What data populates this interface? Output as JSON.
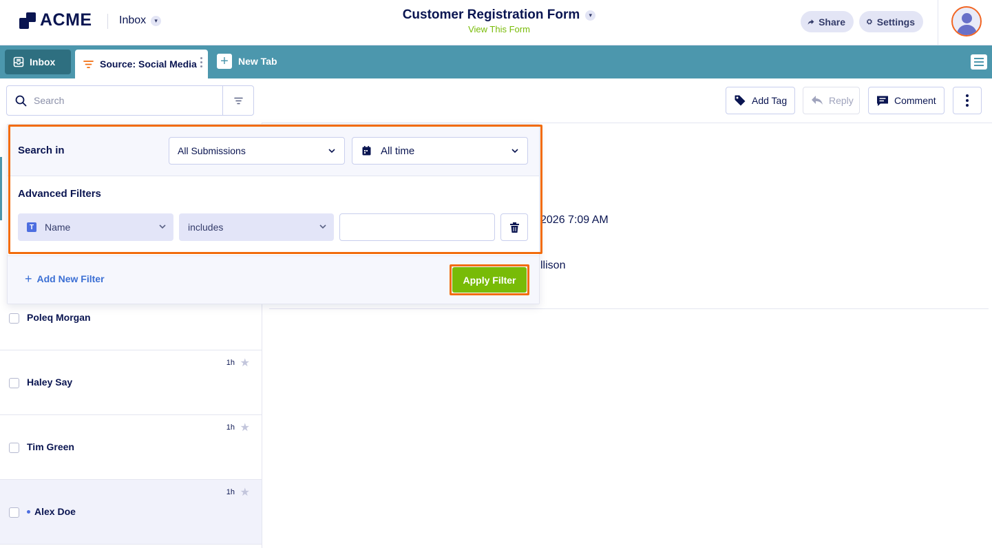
{
  "header": {
    "logo_text": "ACME",
    "inbox_label": "Inbox",
    "form_title": "Customer Registration Form",
    "view_form_link": "View This Form",
    "share_label": "Share",
    "settings_label": "Settings"
  },
  "tabs": {
    "inbox_label": "Inbox",
    "active_label": "Source: Social Media",
    "new_tab_label": "New Tab"
  },
  "toolbar": {
    "search_placeholder": "Search",
    "add_tag_label": "Add Tag",
    "reply_label": "Reply",
    "comment_label": "Comment"
  },
  "filter_panel": {
    "search_in_label": "Search in",
    "submissions_select": "All Submissions",
    "time_select": "All time",
    "advanced_label": "Advanced Filters",
    "field_select": "Name",
    "operator_select": "includes",
    "value": "",
    "add_filter_label": "Add New Filter",
    "apply_label": "Apply Filter"
  },
  "list": {
    "items": [
      {
        "name": "Poleq Morgan",
        "time": "",
        "unread": false
      },
      {
        "name": "Haley Say",
        "time": "1h",
        "unread": false
      },
      {
        "name": "Tim Green",
        "time": "1h",
        "unread": false
      },
      {
        "name": "Alex Doe",
        "time": "1h",
        "unread": true
      }
    ]
  },
  "detail": {
    "date_fragment": "2026 7:09 AM",
    "name_fragment": "llison"
  },
  "colors": {
    "brand_navy": "#0a1551",
    "tab_bar": "#4c97ad",
    "highlight_orange": "#f26c0d",
    "apply_green": "#78bb07",
    "link_blue": "#3b6fd4"
  }
}
